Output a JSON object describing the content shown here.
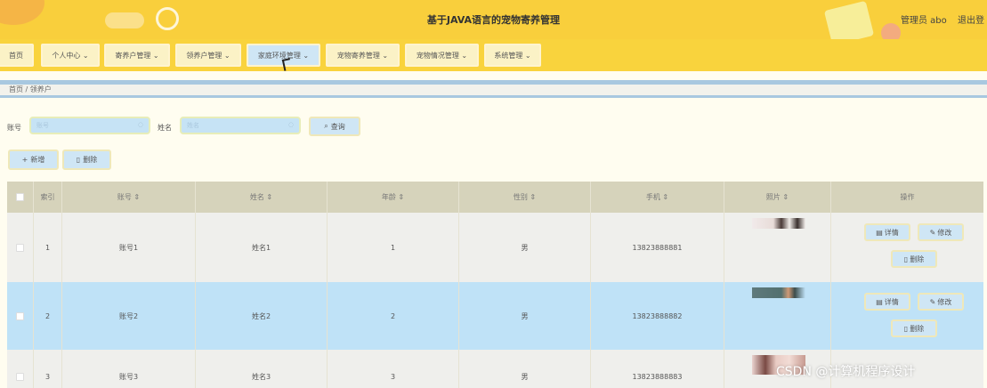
{
  "header": {
    "title": "基于JAVA语言的宠物寄养管理",
    "admin_text": "管理员 abo",
    "logout_text": "退出登"
  },
  "nav": {
    "items": [
      {
        "label": "首页"
      },
      {
        "label": "个人中心 ⌄"
      },
      {
        "label": "寄养户管理 ⌄"
      },
      {
        "label": "领养户管理 ⌄"
      },
      {
        "label": "家庭环境管理 ⌄"
      },
      {
        "label": "宠物寄养管理 ⌄"
      },
      {
        "label": "宠物情况管理 ⌄"
      },
      {
        "label": "系统管理 ⌄"
      }
    ]
  },
  "breadcrumb": {
    "text": "首页 / 领养户"
  },
  "search": {
    "account_label": "账号",
    "account_placeholder": "账号",
    "name_label": "姓名",
    "name_placeholder": "姓名",
    "query_label": "查询"
  },
  "actions": {
    "add_label": "新增",
    "delete_label": "删除"
  },
  "table": {
    "headers": {
      "index": "索引",
      "account": "账号 ⇕",
      "name": "姓名 ⇕",
      "age": "年龄 ⇕",
      "gender": "性别 ⇕",
      "phone": "手机 ⇕",
      "photo": "照片 ⇕",
      "ops": "操作"
    },
    "rows": [
      {
        "index": "1",
        "account": "账号1",
        "name": "姓名1",
        "age": "1",
        "gender": "男",
        "phone": "13823888881"
      },
      {
        "index": "2",
        "account": "账号2",
        "name": "姓名2",
        "age": "2",
        "gender": "男",
        "phone": "13823888882"
      },
      {
        "index": "3",
        "account": "账号3",
        "name": "姓名3",
        "age": "3",
        "gender": "男",
        "phone": "13823888883"
      }
    ],
    "detail_label": "详情",
    "edit_label": "修改",
    "delete_label": "删除"
  },
  "watermark": "CSDN @计算机程序设计",
  "colors": {
    "header_bg": "#f9cf3c",
    "nav_bg": "#f9d33d",
    "button_bg": "#cfe6f5",
    "row_highlight": "#bfe2f7",
    "thead_bg": "#d6d3bb"
  },
  "icons": {
    "search": "search-icon",
    "add": "plus-icon",
    "delete": "trash-icon",
    "detail": "document-icon",
    "edit": "pencil-icon"
  }
}
